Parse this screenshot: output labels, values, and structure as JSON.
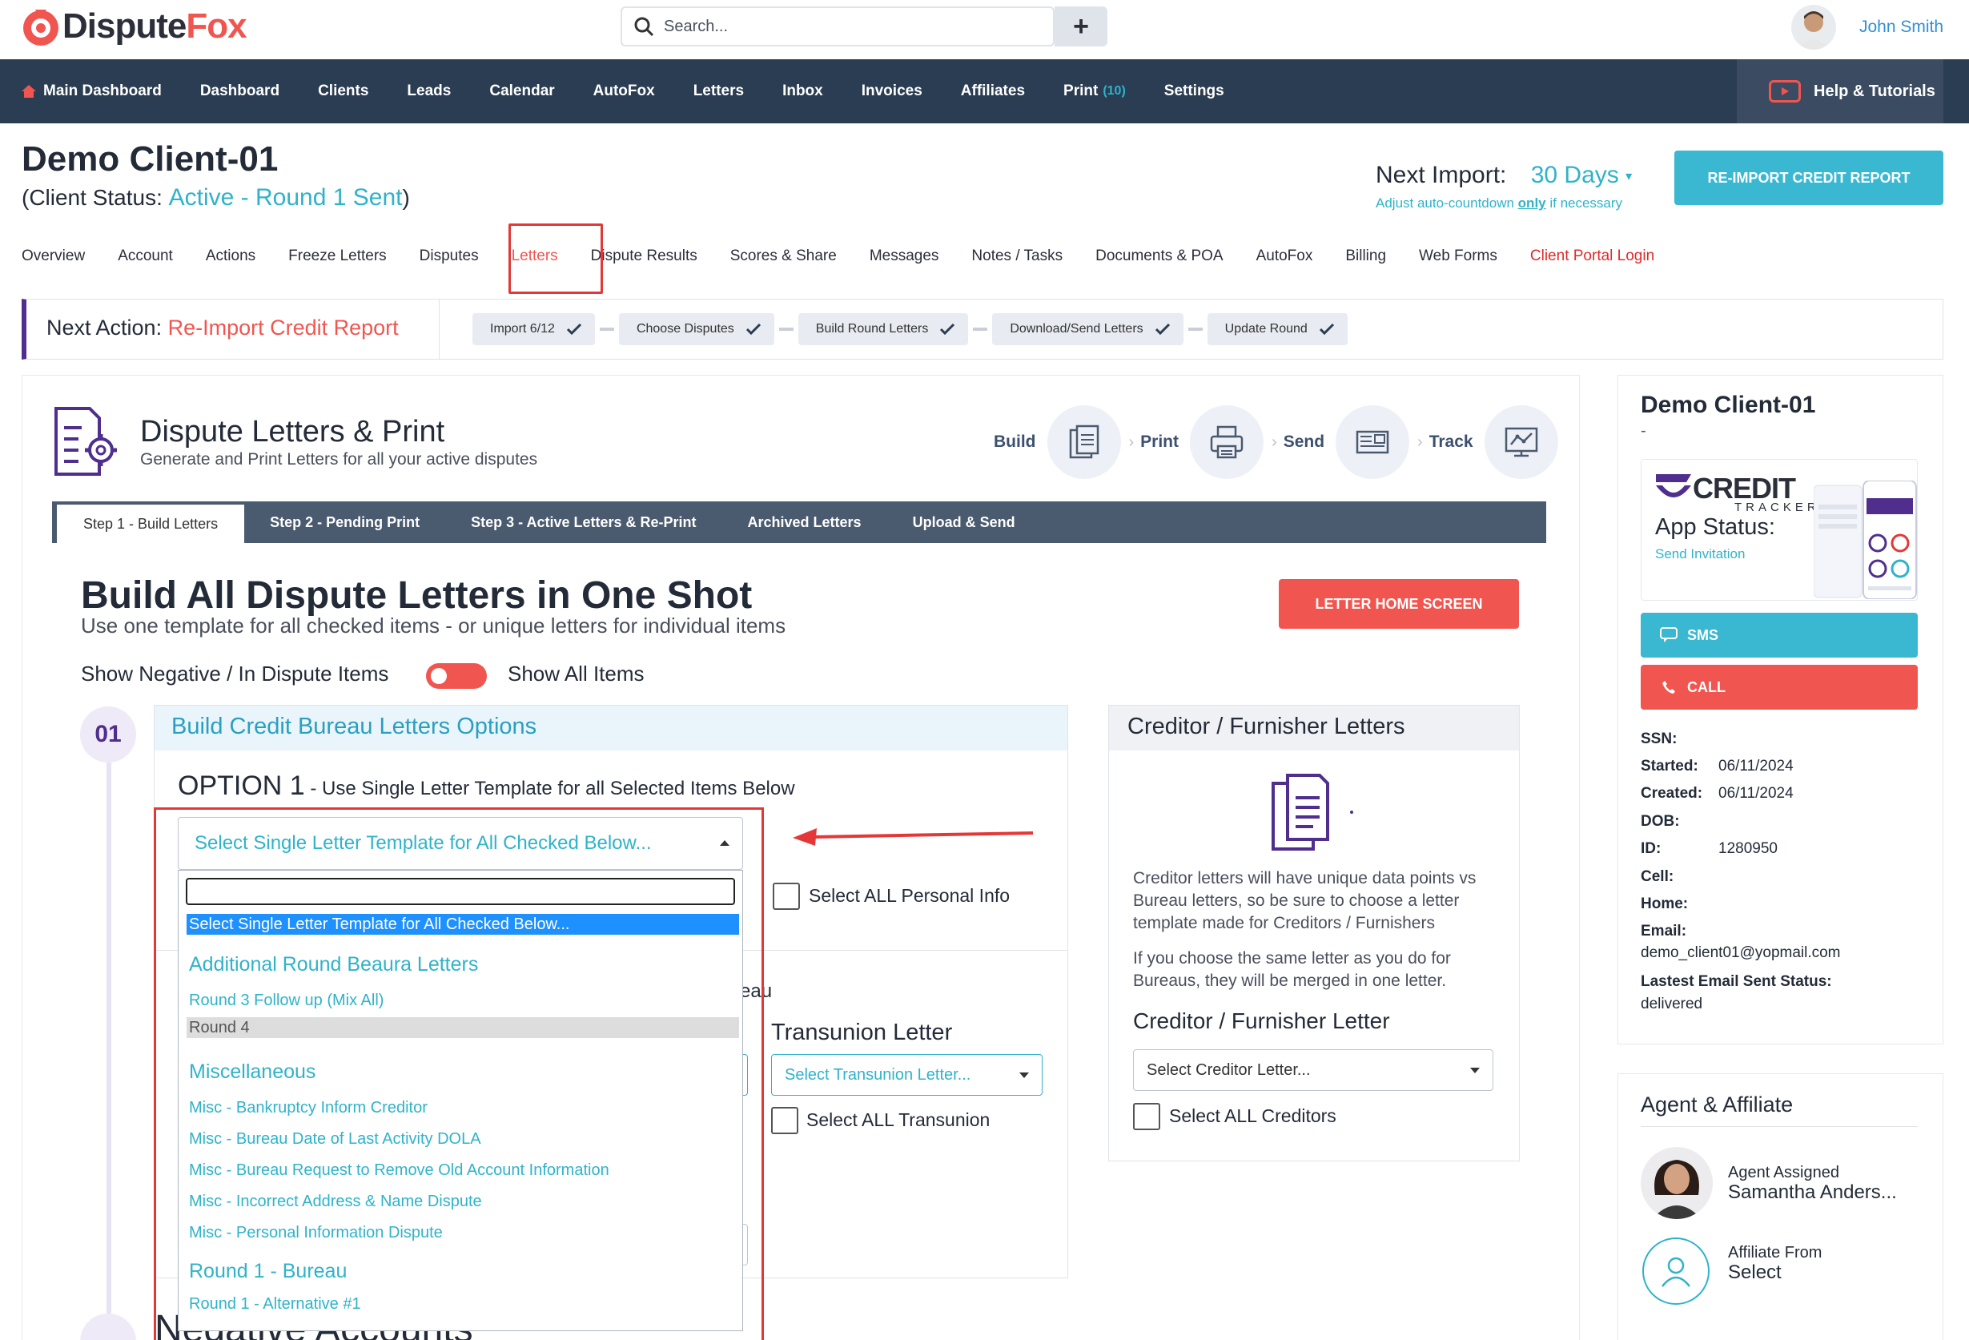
{
  "app": {
    "logo_prefix": "Dispute",
    "logo_suffix": "Fox",
    "search_placeholder": "Search...",
    "add_button": "+",
    "user_name": "John Smith"
  },
  "nav": {
    "items": [
      "Main Dashboard",
      "Dashboard",
      "Clients",
      "Leads",
      "Calendar",
      "AutoFox",
      "Letters",
      "Inbox",
      "Invoices",
      "Affiliates",
      "Print",
      "Settings"
    ],
    "print_count": "(10)",
    "help": "Help & Tutorials"
  },
  "client": {
    "title": "Demo Client-01",
    "status_prefix": "(Client Status: ",
    "status_value": "Active - Round 1 Sent",
    "status_suffix": ")",
    "next_import_label": "Next Import:",
    "next_import_value": "30 Days",
    "adjust_pre": "Adjust auto-countdown ",
    "adjust_only": "only",
    "adjust_post": " if necessary",
    "reimport_button": "RE-IMPORT CREDIT REPORT"
  },
  "tabs": [
    "Overview",
    "Account",
    "Actions",
    "Freeze Letters",
    "Disputes",
    "Letters",
    "Dispute Results",
    "Scores & Share",
    "Messages",
    "Notes / Tasks",
    "Documents & POA",
    "AutoFox",
    "Billing",
    "Web Forms",
    "Client Portal Login"
  ],
  "next_action": {
    "label": "Next Action: ",
    "value": "Re-Import Credit Report",
    "steps": [
      "Import 6/12",
      "Choose Disputes",
      "Build Round Letters",
      "Download/Send Letters",
      "Update Round"
    ]
  },
  "letters_page": {
    "title": "Dispute Letters & Print",
    "subtitle": "Generate and Print Letters for all your active disputes",
    "process": [
      "Build",
      "Print",
      "Send",
      "Track"
    ],
    "step_tabs": [
      "Step 1 - Build Letters",
      "Step 2 - Pending Print",
      "Step 3 - Active Letters & Re-Print",
      "Archived Letters",
      "Upload & Send"
    ],
    "build_title": "Build All Dispute Letters in One Shot",
    "build_subtitle": "Use one template for all checked items - or unique letters for individual items",
    "letter_home_button": "LETTER HOME SCREEN",
    "toggle_left": "Show Negative / In Dispute Items",
    "toggle_right": "Show All Items",
    "toggle_on": true,
    "step_number": "01"
  },
  "bureau": {
    "section_title": "Build Credit Bureau Letters Options",
    "option_label": "OPTION 1",
    "option_desc": " - Use Single Letter Template for all Selected Items Below",
    "select_placeholder": "Select Single Letter Template for All Checked Below...",
    "select_all_personal_pre": "Select ",
    "select_all_personal_bold": "ALL Personal Info",
    "fragment": "eau",
    "transunion_title": "Transunion Letter",
    "transunion_select": "Select Transunion Letter...",
    "select_all_tu_pre": "Select ",
    "select_all_tu_bold": "ALL Transunion",
    "negative_accounts": "Negative Accounts"
  },
  "dropdown": {
    "search_value": "",
    "selected": "Select Single Letter Template for All Checked Below...",
    "groups": [
      {
        "label": "Additional Round Beaura Letters",
        "options": [
          "Round 3 Follow up (Mix All)",
          "Round 4"
        ]
      },
      {
        "label": "Miscellaneous",
        "options": [
          "Misc - Bankruptcy Inform Creditor",
          "Misc - Bureau Date of Last Activity DOLA",
          "Misc - Bureau Request to Remove Old Account Information",
          "Misc - Incorrect Address & Name Dispute",
          "Misc - Personal Information Dispute"
        ]
      },
      {
        "label": "Round 1 - Bureau",
        "options": [
          "Round 1 - Alternative #1"
        ]
      }
    ],
    "hovered": "Round 4"
  },
  "creditor": {
    "title": "Creditor / Furnisher Letters",
    "text1": "Creditor letters will have unique data points vs Bureau letters, so be sure to choose a letter template made for Creditors / Furnishers",
    "text2": "If you choose the same letter as you do for Bureaus, they will be merged in one letter.",
    "subtitle": "Creditor / Furnisher Letter",
    "select": "Select Creditor Letter...",
    "select_all_pre": "Select ",
    "select_all_bold": "ALL Creditors"
  },
  "sidebar": {
    "name": "Demo Client-01",
    "dash": "-",
    "ct_credit": "CREDIT",
    "ct_tracker": "TRACKER",
    "app_status": "App Status:",
    "send_invitation": "Send Invitation",
    "sms": "SMS",
    "call": "CALL",
    "info": {
      "ssn_label": "SSN:",
      "started_label": "Started:",
      "started": "06/11/2024",
      "created_label": "Created:",
      "created": "06/11/2024",
      "dob_label": "DOB:",
      "id_label": "ID:",
      "id": "1280950",
      "cell_label": "Cell:",
      "home_label": "Home:",
      "email_label": "Email:",
      "email": "demo_client01@yopmail.com",
      "status_label": "Lastest Email Sent Status:",
      "status": "delivered"
    },
    "agent_title": "Agent & Affiliate",
    "agent_label": "Agent Assigned",
    "agent_name": "Samantha Anders...",
    "affiliate_label": "Affiliate From",
    "affiliate_value": "Select"
  },
  "colors": {
    "navbar": "#2b3d52",
    "accent_teal": "#2fb3c9",
    "accent_red": "#f1554f",
    "brand_purple": "#4f2e8e",
    "highlight_red": "#e43838"
  },
  "icons": [
    "search-icon",
    "home-icon",
    "youtube-icon",
    "checkmark-icon",
    "document-settings-icon",
    "build-icon",
    "print-icon",
    "send-icon",
    "track-icon",
    "documents-icon",
    "chat-icon",
    "phone-icon",
    "user-icon",
    "arrow-icon"
  ]
}
